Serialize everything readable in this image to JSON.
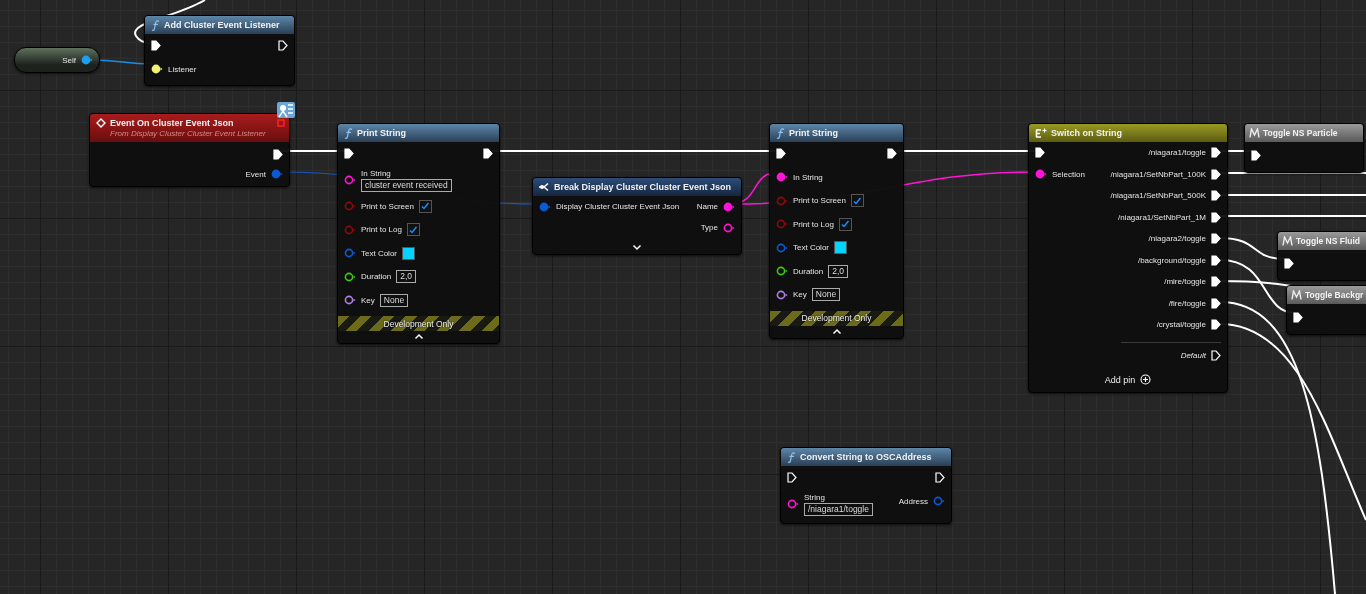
{
  "nodes": [
    {
      "kind": "self",
      "outputs": [
        {
          "label": "Self",
          "kind": "data",
          "color": "#1ea0f0",
          "connected": true
        }
      ]
    },
    {
      "kind": "function",
      "title": "Add Cluster Event Listener",
      "inputs": [
        {
          "kind": "exec",
          "connected": true
        },
        {
          "label": "Listener",
          "kind": "data",
          "color": "#f0f078",
          "connected": true
        }
      ],
      "outputs": [
        {
          "kind": "exec",
          "connected": false
        }
      ]
    },
    {
      "kind": "event",
      "title": "Event On Cluster Event Json",
      "subtitle": "From Display Cluster Cluster Event Listener",
      "outputs": [
        {
          "kind": "exec",
          "connected": true
        },
        {
          "label": "Event",
          "kind": "data",
          "color": "#0a5ad8",
          "connected": true
        }
      ]
    },
    {
      "kind": "function",
      "title": "Print String",
      "inputs": [
        {
          "kind": "exec",
          "connected": true
        },
        {
          "label": "In String",
          "kind": "data",
          "color": "#ff14d8",
          "connected": false,
          "value": "cluster event received"
        },
        {
          "label": "Print to Screen",
          "kind": "data",
          "color": "#8c0a0a",
          "connected": false,
          "checked": true
        },
        {
          "label": "Print to Log",
          "kind": "data",
          "color": "#8c0a0a",
          "connected": false,
          "checked": true
        },
        {
          "label": "Text Color",
          "kind": "data",
          "color": "#0a5ad8",
          "connected": false,
          "swatch": {
            "color": "#00d4ff"
          }
        },
        {
          "label": "Duration",
          "kind": "data",
          "color": "#3ccc0a",
          "connected": false,
          "value": "2,0"
        },
        {
          "label": "Key",
          "kind": "data",
          "color": "#b07ee8",
          "connected": false,
          "value": "None"
        }
      ],
      "outputs": [
        {
          "kind": "exec",
          "connected": true
        }
      ],
      "footer": "Development Only",
      "expanded": true
    },
    {
      "kind": "break",
      "title": "Break Display Cluster Cluster Event Json",
      "inputs": [
        {
          "label": "Display Cluster Cluster Event Json",
          "kind": "data",
          "color": "#0a5ad8",
          "connected": true
        }
      ],
      "outputs": [
        {
          "label": "Name",
          "kind": "data",
          "color": "#ff14d8",
          "connected": true
        },
        {
          "label": "Type",
          "kind": "data",
          "color": "#ff14d8",
          "connected": false
        }
      ],
      "expanded": false
    },
    {
      "kind": "function",
      "title": "Print String",
      "inputs": [
        {
          "kind": "exec",
          "connected": true
        },
        {
          "label": "In String",
          "kind": "data",
          "color": "#ff14d8",
          "connected": true
        },
        {
          "label": "Print to Screen",
          "kind": "data",
          "color": "#8c0a0a",
          "connected": false,
          "checked": true
        },
        {
          "label": "Print to Log",
          "kind": "data",
          "color": "#8c0a0a",
          "connected": false,
          "checked": true
        },
        {
          "label": "Text Color",
          "kind": "data",
          "color": "#0a5ad8",
          "connected": false,
          "swatch": {
            "color": "#00d4ff"
          }
        },
        {
          "label": "Duration",
          "kind": "data",
          "color": "#3ccc0a",
          "connected": false,
          "value": "2,0"
        },
        {
          "label": "Key",
          "kind": "data",
          "color": "#b07ee8",
          "connected": false,
          "value": "None"
        }
      ],
      "outputs": [
        {
          "kind": "exec",
          "connected": true
        }
      ],
      "footer": "Development Only",
      "expanded": true
    },
    {
      "kind": "switch",
      "title": "Switch on String",
      "inputs": [
        {
          "kind": "exec",
          "connected": true
        },
        {
          "label": "Selection",
          "kind": "data",
          "color": "#ff14d8",
          "connected": true
        }
      ],
      "outputs": [
        {
          "label": "/niagara1/toggle",
          "kind": "exec",
          "connected": true
        },
        {
          "label": "/niagara1/SetNbPart_100K",
          "kind": "exec",
          "connected": true
        },
        {
          "label": "/niagara1/SetNbPart_500K",
          "kind": "exec",
          "connected": true
        },
        {
          "label": "/niagara1/SetNbPart_1M",
          "kind": "exec",
          "connected": true
        },
        {
          "label": "/niagara2/toggle",
          "kind": "exec",
          "connected": true
        },
        {
          "label": "/background/toggle",
          "kind": "exec",
          "connected": true
        },
        {
          "label": "/mire/toggle",
          "kind": "exec",
          "connected": true
        },
        {
          "label": "/fire/toggle",
          "kind": "exec",
          "connected": true
        },
        {
          "label": "/crystal/toggle",
          "kind": "exec",
          "connected": true
        }
      ],
      "default_pin": {
        "label": "Default",
        "connected": false
      },
      "add_pin": "Add pin"
    },
    {
      "kind": "macro",
      "title": "Toggle NS Particle",
      "inputs": [
        {
          "kind": "exec",
          "connected": true
        }
      ]
    },
    {
      "kind": "macro",
      "title": "Toggle NS Fluid",
      "inputs": [
        {
          "kind": "exec",
          "connected": true
        }
      ]
    },
    {
      "kind": "macro",
      "title": "Toggle Backgr",
      "inputs": [
        {
          "kind": "exec",
          "connected": true
        }
      ]
    },
    {
      "kind": "function",
      "title": "Convert String to OSCAddress",
      "inputs": [
        {
          "kind": "exec",
          "connected": false
        },
        {
          "label": "String",
          "kind": "data",
          "color": "#ff14d8",
          "connected": false,
          "value": "/niagara1/toggle"
        }
      ],
      "outputs": [
        {
          "kind": "exec",
          "connected": false
        },
        {
          "label": "Address",
          "kind": "data",
          "color": "#0a5ad8",
          "connected": false
        }
      ]
    }
  ]
}
